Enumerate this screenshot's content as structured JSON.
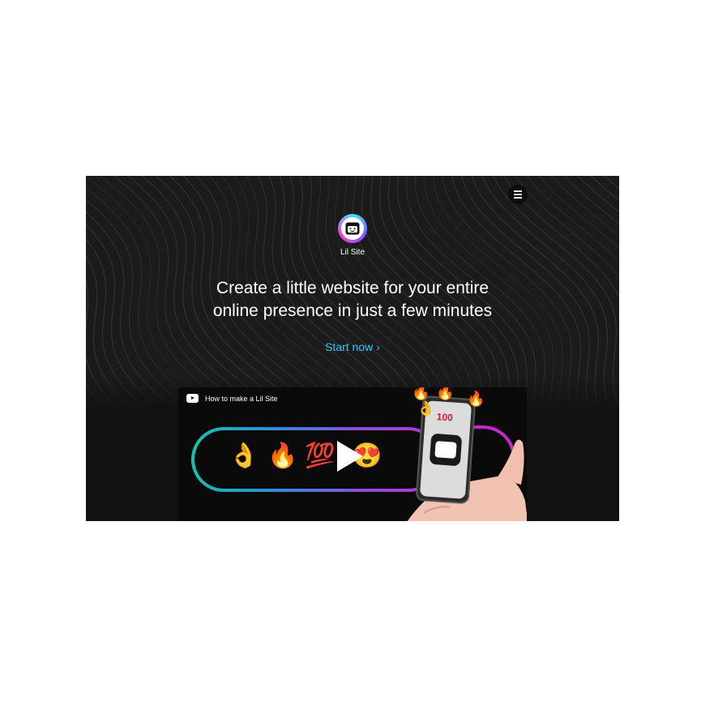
{
  "menu": {
    "icon": "hamburger-menu-icon"
  },
  "brand": {
    "name": "Lil Site",
    "logo_icon": "lil-site-logo-icon"
  },
  "hero": {
    "headline_line1": "Create a little website for your entire",
    "headline_line2": "online presence in just a few minutes",
    "cta_label": "Start now",
    "cta_icon": "chevron-right-icon",
    "cta_color": "#2ec7ff"
  },
  "video": {
    "title": "How to make a Lil Site",
    "source_icon": "youtube-icon",
    "play_icon": "play-icon",
    "thumbnail_text": "100",
    "emojis": [
      "👌",
      "🔥",
      "💯",
      "😍"
    ]
  },
  "colors": {
    "background": "#121212",
    "pill_gradient": [
      "#19c0b0",
      "#2a8fd6",
      "#8a4fe0",
      "#c02fd0"
    ]
  }
}
